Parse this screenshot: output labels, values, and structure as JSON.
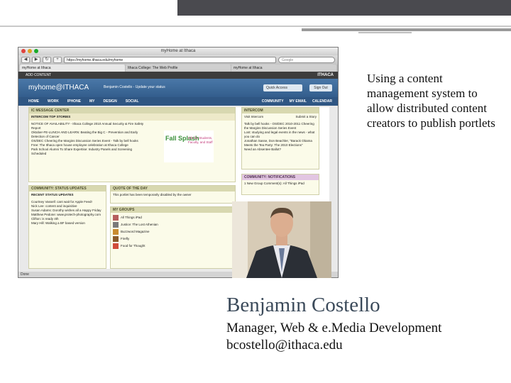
{
  "caption": "Using a content management system to allow distributed content creators to publish portlets",
  "presenter": {
    "name": "Benjamin Costello",
    "title": "Manager, Web & e.Media Development",
    "email": "bcostello@ithaca.edu"
  },
  "screenshot": {
    "window_title": "myHome at Ithaca",
    "url": "https://myhome.ithaca.edu/myhome",
    "search_placeholder": "Google",
    "tabs": [
      "myHome at Ithaca",
      "Ithaca College: The Web Profile",
      "myHome at Ithaca"
    ],
    "add_content_label": "ADD CONTENT",
    "brand_text": "ITHACA",
    "logo_text": "myhome@ITHACA",
    "user_label": "Benjamin Costello - Update your status",
    "quick_access_label": "Quick Access",
    "signout_label": "Sign Out",
    "nav_items": [
      "HOME",
      "WORK",
      "IPHONE",
      "MY",
      "DESIGN",
      "SOCIAL"
    ],
    "nav_right_items": [
      "COMMUNITY",
      "MY EMAIL",
      "CALENDAR"
    ],
    "portlets": {
      "message_center": {
        "title": "IC MESSAGE CENTER",
        "subtitle": "INTERCOM TOP STORIES",
        "items": [
          "NOTICE OF AVAILABILITY - Ithaca College 2010 Annual Security & Fire Safety Report",
          "Oktober-FE-LUNCH AND LEARN: Beating the Big C - Prevention and Early Detection of Cancer",
          "OS/DEC Cheering the Margins Discussion Series Event - Talk by bell hooks",
          "Free: The Ithaca open house employee celebration at Ithaca College",
          "Park School Alumni To Share Expertise: Industry Panels and Screening Scheduled"
        ]
      },
      "fall_splash": {
        "title": "Fall Splash",
        "info": "Info for Students, Faculty, and Staff"
      },
      "intercom": {
        "title": "INTERCOM",
        "visit_label": "Visit Intercom",
        "submit_label": "Submit a Story",
        "items": [
          "Talk by bell hooks - OS/DEC 2010-2011 Cheering the Margins Discussion Series Event",
          "Lost: studying and legal events in the news - what you can do",
          "Jonathan Sasse, Don Beachler, \"Barack Obama Meets the Tea Party: The 2010 Elections\"",
          "Need an Absentee Ballot?"
        ]
      },
      "community_status": {
        "title": "COMMUNITY: STATUS UPDATES",
        "subtitle": "RECENT STATUS UPDATES",
        "items": [
          "Courtney Vassell: cant wait for Apple Feed!",
          "Nick Lee: content and inquisitive",
          "Susan Adams: Dorothy wishes all a Happy Friday",
          "Matthew Pedone: www.protech-photography.com",
          "Clifton: is ready 4th",
          "Mary Hill: Walking a BF based version"
        ]
      },
      "quote": {
        "title": "QUOTE OF THE DAY",
        "text": "This portlet has been temporarily disabled by the owner"
      },
      "my_groups": {
        "title": "MY GROUPS",
        "items": [
          "All Things iPad",
          "Justice: The Lost Athenian",
          "Buzzword Magazine",
          "Firefly",
          "Food for Thought"
        ]
      },
      "notifications": {
        "title": "COMMUNITY: NOTIFICATIONS",
        "items": [
          "1 New Group Comment(s): All Things iPad"
        ]
      }
    },
    "status_text": "Done"
  },
  "colors": {
    "header_blue": "#3b6797",
    "portlet_bg": "#fbfbe9",
    "name_color": "#3b4a5a",
    "topbar_dark": "#4a4a4f"
  }
}
